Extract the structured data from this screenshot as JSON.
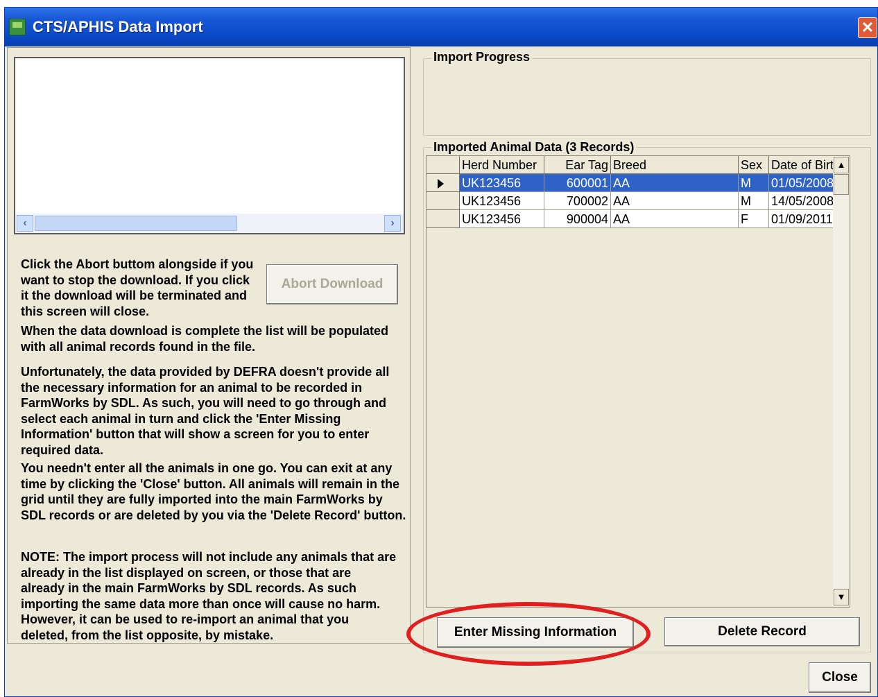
{
  "window": {
    "title": "CTS/APHIS Data Import",
    "close_glyph": "✕"
  },
  "left_panel": {
    "abort_button": "Abort Download",
    "abort_text": "Click the Abort buttom alongside if you want to stop the download. If you click it the download will be terminated and this screen will close.",
    "paragraphs": [
      "When the data download is complete the list will be populated with all animal records found in the file.",
      "Unfortunately, the data provided by DEFRA doesn't provide all the necessary information for an animal to be recorded in FarmWorks by SDL. As such, you will need to go through and select each animal in turn and click the 'Enter Missing Information' button that will show a screen for you to enter required data.",
      "You needn't enter all the animals in one go. You can exit at any time by clicking the 'Close' button. All animals will remain in the grid until they are fully imported into the main FarmWorks by SDL records or are deleted by you via the 'Delete Record' button.",
      "NOTE: The import process will not include any animals that are already in the list displayed on screen, or those that are already in the main FarmWorks by SDL records. As such importing the same data more than once will cause no harm. However, it can be used to re-import an animal that you deleted, from the list opposite, by mistake."
    ]
  },
  "import_progress": {
    "label": "Import Progress"
  },
  "imported": {
    "label": "Imported Animal Data (3 Records)",
    "columns": [
      "Herd Number",
      "Ear Tag",
      "Breed",
      "Sex",
      "Date of Birth"
    ],
    "rows": [
      [
        "UK123456",
        "600001",
        "AA",
        "M",
        "01/05/2008"
      ],
      [
        "UK123456",
        "700002",
        "AA",
        "M",
        "14/05/2008"
      ],
      [
        "UK123456",
        "900004",
        "AA",
        "F",
        "01/09/2011"
      ]
    ],
    "selected_row": 0
  },
  "buttons": {
    "enter_missing": "Enter Missing Information",
    "delete_record": "Delete Record",
    "close": "Close"
  },
  "icons": {
    "app": "app-icon",
    "close": "close-icon",
    "scroll_left": "chevron-left-icon",
    "scroll_right": "chevron-right-icon",
    "scroll_up": "arrow-up-icon",
    "scroll_down": "arrow-down-icon",
    "row_pointer": "row-pointer-icon"
  },
  "colors": {
    "title_bar": "#0a49c8",
    "selected_row": "#2f62c6",
    "highlight_ellipse": "#e02020",
    "window_bg": "#ece9d8"
  }
}
